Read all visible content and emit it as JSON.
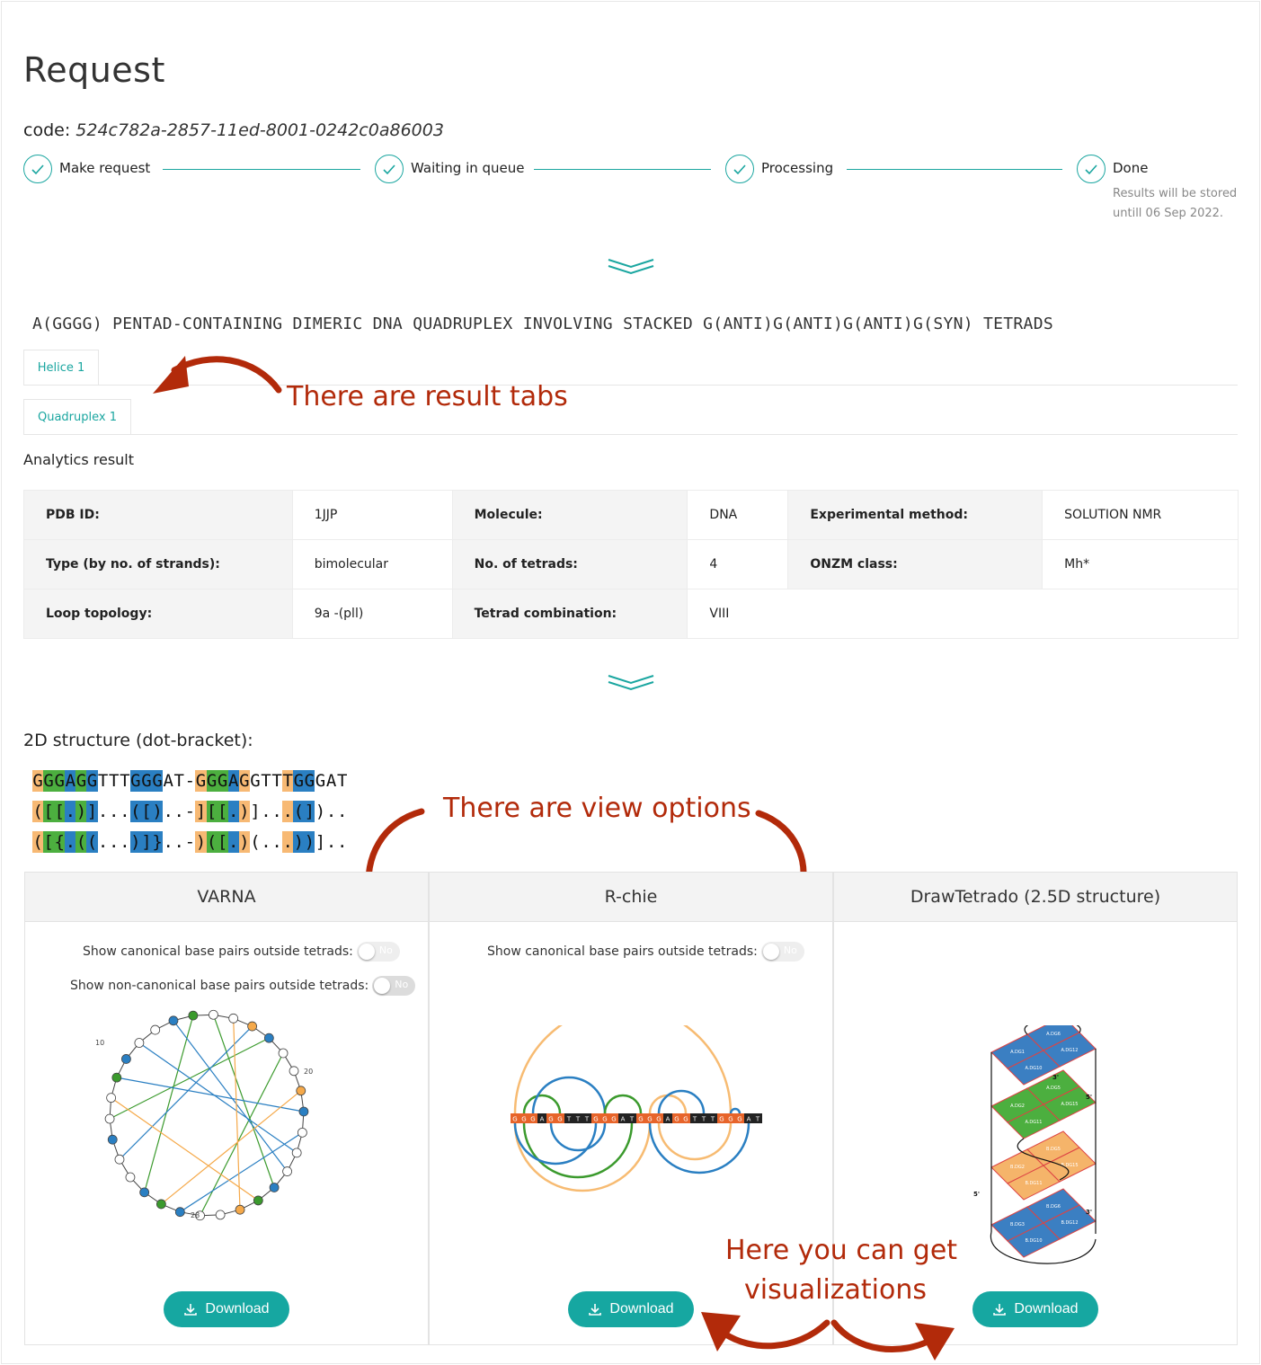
{
  "page": {
    "title": "Request"
  },
  "request": {
    "code_label": "code:",
    "code_value": "524c782a-2857-11ed-8001-0242c0a86003"
  },
  "steps": [
    {
      "label": "Make request"
    },
    {
      "label": "Waiting in queue"
    },
    {
      "label": "Processing"
    },
    {
      "label": "Done",
      "description": "Results will be stored untill 06 Sep 2022."
    }
  ],
  "structure": {
    "title": "A(GGGG) PENTAD-CONTAINING DIMERIC DNA QUADRUPLEX INVOLVING STACKED G(ANTI)G(ANTI)G(ANTI)G(SYN) TETRADS"
  },
  "tabs": [
    {
      "label": "Helice 1"
    },
    {
      "label": "Quadruplex 1"
    }
  ],
  "annotations": {
    "tabs": "There are result tabs",
    "views": "There are view options",
    "viz_line1": "Here you can get",
    "viz_line2": "visualizations"
  },
  "analytics": {
    "title": "Analytics result",
    "rows": [
      [
        {
          "k": "PDB ID:",
          "v": "1JJP"
        },
        {
          "k": "Molecule:",
          "v": "DNA"
        },
        {
          "k": "Experimental method:",
          "v": "SOLUTION NMR"
        }
      ],
      [
        {
          "k": "Type (by no. of strands):",
          "v": "bimolecular"
        },
        {
          "k": "No. of tetrads:",
          "v": "4"
        },
        {
          "k": "ONZM class:",
          "v": "Mh*"
        }
      ],
      [
        {
          "k": "Loop topology:",
          "v": "9a -(pll)"
        },
        {
          "k": "Tetrad combination:",
          "v": "VIII"
        }
      ]
    ]
  },
  "dotbracket": {
    "title": "2D structure (dot-bracket):",
    "lines": [
      "GGGAGGTTTGGGAT-GGGAGGTTTGGGAT",
      "([[.)]...([)..-][[.)]...(])..",
      "([{.((...)]}..-)([.)(...))].."
    ],
    "colors": "oggbgbnnnbbbnn-oggbonnnobbnn"
  },
  "panels": [
    {
      "title": "VARNA",
      "toggles": [
        {
          "label": "Show canonical base pairs outside tetrads:",
          "state": "No"
        },
        {
          "label": "Show non-canonical base pairs outside tetrads:",
          "state": "No"
        }
      ],
      "download": "Download"
    },
    {
      "title": "R-chie",
      "toggles": [
        {
          "label": "Show canonical base pairs outside tetrads:",
          "state": "No"
        }
      ],
      "download": "Download"
    },
    {
      "title": "DrawTetrado (2.5D structure)",
      "toggles": [],
      "download": "Download"
    }
  ],
  "varna": {
    "labels": [
      "10",
      "20",
      "28"
    ]
  },
  "rchie": {
    "sequence": "GGGAGGTTTGGGATGGGAGGTTTGGGAT"
  },
  "drawtetrado": {
    "nucleotides": [
      "A.DG1",
      "A.DG6",
      "A.DG10",
      "A.DG12",
      "A.DG2",
      "A.DG5",
      "A.DG11",
      "A.DG15",
      "B.DG2",
      "B.DG5",
      "B.DG11",
      "B.DG15",
      "B.DG3",
      "B.DG6",
      "B.DG10",
      "B.DG12"
    ],
    "ends": [
      "3'",
      "5'",
      "5'",
      "3'"
    ]
  },
  "colors": {
    "accent": "#16a7a1",
    "annotation": "#b22a0a"
  }
}
